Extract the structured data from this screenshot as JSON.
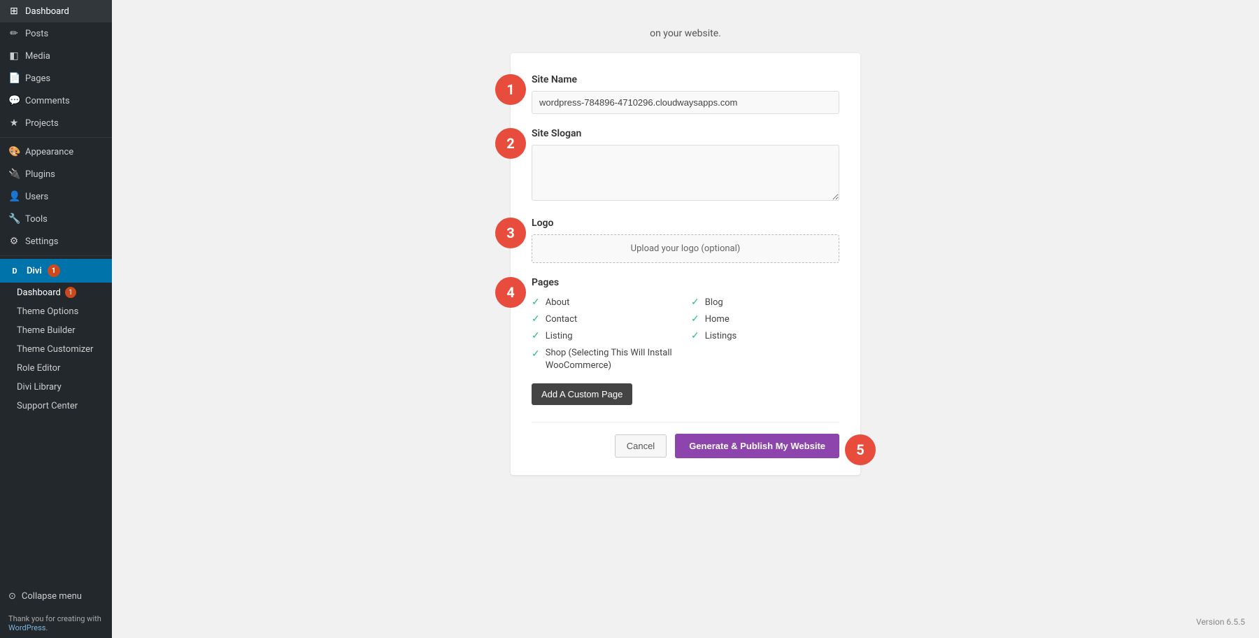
{
  "sidebar": {
    "items": [
      {
        "label": "Dashboard",
        "icon": "⊞"
      },
      {
        "label": "Posts",
        "icon": "✏"
      },
      {
        "label": "Media",
        "icon": "◧"
      },
      {
        "label": "Pages",
        "icon": "📄"
      },
      {
        "label": "Comments",
        "icon": "💬"
      },
      {
        "label": "Projects",
        "icon": "★"
      }
    ],
    "appearance": {
      "label": "Appearance",
      "icon": "🎨"
    },
    "plugins": {
      "label": "Plugins",
      "icon": "🔌"
    },
    "users": {
      "label": "Users",
      "icon": "👤"
    },
    "tools": {
      "label": "Tools",
      "icon": "🔧"
    },
    "settings": {
      "label": "Settings",
      "icon": "⚙"
    },
    "divi": {
      "label": "Divi",
      "badge": "1",
      "sub_items": [
        {
          "label": "Dashboard",
          "badge": "1"
        },
        {
          "label": "Theme Options"
        },
        {
          "label": "Theme Builder"
        },
        {
          "label": "Theme Customizer"
        },
        {
          "label": "Role Editor"
        },
        {
          "label": "Divi Library"
        },
        {
          "label": "Support Center"
        }
      ]
    },
    "collapse": "Collapse menu"
  },
  "footer": {
    "text": "Thank you for creating with ",
    "link": "WordPress",
    "version": "Version 6.5.5"
  },
  "main": {
    "top_text": "on your website.",
    "steps": {
      "step1": "1",
      "step2": "2",
      "step3": "3",
      "step4": "4",
      "step5": "5"
    },
    "site_name_label": "Site Name",
    "site_name_value": "wordpress-784896-4710296.cloudwaysapps.com",
    "site_slogan_label": "Site Slogan",
    "site_slogan_placeholder": "",
    "logo_label": "Logo",
    "logo_upload_text": "Upload your logo (optional)",
    "pages_label": "Pages",
    "pages": [
      {
        "label": "About",
        "checked": true,
        "col": 1
      },
      {
        "label": "Blog",
        "checked": true,
        "col": 2
      },
      {
        "label": "Contact",
        "checked": true,
        "col": 1
      },
      {
        "label": "Home",
        "checked": true,
        "col": 2
      },
      {
        "label": "Listing",
        "checked": true,
        "col": 1
      },
      {
        "label": "Listings",
        "checked": true,
        "col": 2
      },
      {
        "label": "Shop (Selecting This Will Install WooCommerce)",
        "checked": true,
        "col": 1
      }
    ],
    "add_custom_page_btn": "Add A Custom Page",
    "cancel_btn": "Cancel",
    "publish_btn": "Generate & Publish My Website"
  }
}
